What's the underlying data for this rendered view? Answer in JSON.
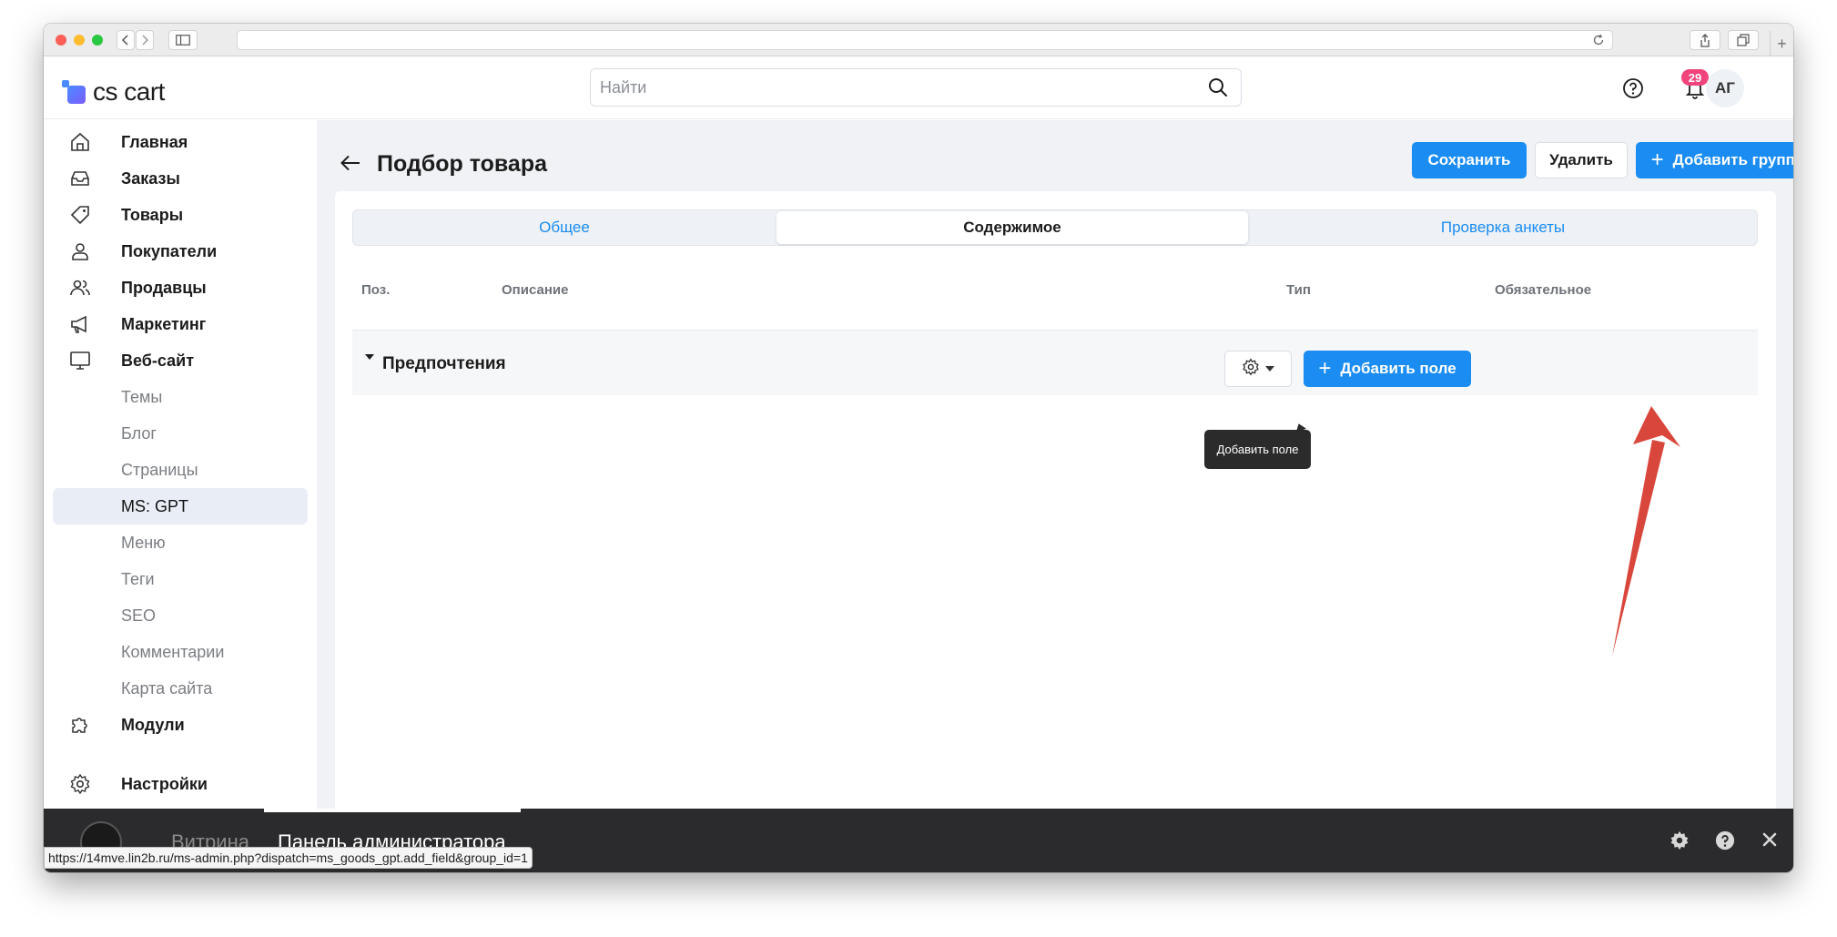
{
  "browser": {
    "status_url": "https://14mve.lin2b.ru/ms-admin.php?dispatch=ms_goods_gpt.add_field&group_id=1"
  },
  "header": {
    "logo_text": "cs cart",
    "search_placeholder": "Найти",
    "notifications_count": "29",
    "avatar_initials": "АГ"
  },
  "sidebar": {
    "items": [
      {
        "label": "Главная",
        "icon": "home-icon"
      },
      {
        "label": "Заказы",
        "icon": "inbox-icon"
      },
      {
        "label": "Товары",
        "icon": "tag-icon"
      },
      {
        "label": "Покупатели",
        "icon": "user-icon"
      },
      {
        "label": "Продавцы",
        "icon": "users-icon"
      },
      {
        "label": "Маркетинг",
        "icon": "megaphone-icon"
      },
      {
        "label": "Веб-сайт",
        "icon": "monitor-icon"
      }
    ],
    "subitems": [
      {
        "label": "Темы"
      },
      {
        "label": "Блог"
      },
      {
        "label": "Страницы"
      },
      {
        "label": "MS: GPT",
        "active": true
      },
      {
        "label": "Меню"
      },
      {
        "label": "Теги"
      },
      {
        "label": "SEO"
      },
      {
        "label": "Комментарии"
      },
      {
        "label": "Карта сайта"
      }
    ],
    "modules": {
      "label": "Модули",
      "icon": "puzzle-icon"
    },
    "settings": {
      "label": "Настройки",
      "icon": "gear-icon"
    }
  },
  "page": {
    "title": "Подбор товара",
    "buttons": {
      "save": "Сохранить",
      "delete": "Удалить",
      "add_group": "Добавить группу"
    },
    "tabs": [
      {
        "label": "Общее"
      },
      {
        "label": "Содержимое",
        "active": true
      },
      {
        "label": "Проверка анкеты"
      }
    ],
    "table": {
      "columns": [
        "Поз.",
        "Описание",
        "Тип",
        "Обязательное"
      ]
    },
    "group": {
      "name": "Предпочтения",
      "add_field_label": "Добавить поле",
      "tooltip": "Добавить поле"
    }
  },
  "bottom_bar": {
    "storefront": "Витрина",
    "admin_panel": "Панель администратора"
  },
  "colors": {
    "accent": "#1a8cf2",
    "badge": "#f0447a",
    "arrow": "#d9463b"
  }
}
